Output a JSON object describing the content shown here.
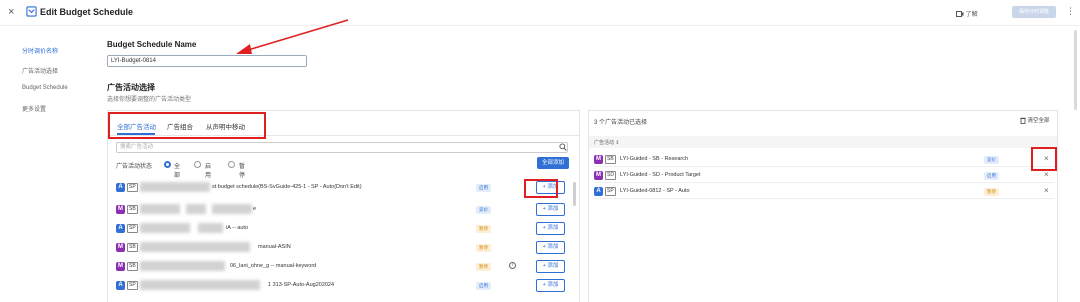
{
  "header": {
    "close": "×",
    "title": "Edit Budget Schedule",
    "help": "了解",
    "save": "保存分时调整",
    "more": "⋮"
  },
  "sidebar": {
    "items": [
      {
        "label": "分时调价名称",
        "active": true
      },
      {
        "label": "广告活动选择",
        "active": false
      },
      {
        "label": "Budget Schedule",
        "active": false
      },
      {
        "label": "更多设置",
        "active": false
      }
    ]
  },
  "schedule_name": {
    "label": "Budget Schedule Name",
    "value": "LYI-Budget-0814"
  },
  "campaign_select": {
    "label": "广告活动选择",
    "sub": "选择你想要调整的广告活动类型"
  },
  "tabs": [
    {
      "label": "全部广告活动",
      "active": true
    },
    {
      "label": "广告组合",
      "active": false
    },
    {
      "label": "从声明中移动",
      "active": false
    }
  ],
  "search": {
    "placeholder": "搜索广告活动"
  },
  "filter": {
    "label": "广告活动状态",
    "options": [
      "全部",
      "启用",
      "暂停"
    ],
    "add_all": "全部添加"
  },
  "left_rows": [
    {
      "type": "A",
      "tag": "SP",
      "name": "st budget schedule(BS-SvGuide-425-1 - SP - Auto(Don't Edit)",
      "status": "启用",
      "status_color": "#2f6fd6",
      "status_bg": "#e3ecfb",
      "add": "+ 添加"
    },
    {
      "type": "M",
      "tag": "SB",
      "name": "e",
      "status": "竞价",
      "status_color": "#2f6fd6",
      "status_bg": "#e3ecfb",
      "add": "+ 添加"
    },
    {
      "type": "A",
      "tag": "SP",
      "name": "iA -- auto",
      "status": "暂停",
      "status_color": "#d08a12",
      "status_bg": "#fdefd5",
      "add": "+ 添加"
    },
    {
      "type": "M",
      "tag": "SB",
      "name": "manual-ASIN",
      "status": "暂停",
      "status_color": "#d08a12",
      "status_bg": "#fdefd5",
      "add": "+ 添加"
    },
    {
      "type": "M",
      "tag": "SB",
      "name": "06_lani_ohne_g -- manual-keyword",
      "status": "暂停",
      "status_color": "#d08a12",
      "status_bg": "#fdefd5",
      "add": "+ 添加",
      "info": "i"
    },
    {
      "type": "A",
      "tag": "SP",
      "name": "1 313-SP-Auto-Aug202024",
      "status": "启用",
      "status_color": "#2f6fd6",
      "status_bg": "#e3ecfb",
      "add": "+ 添加"
    }
  ],
  "right_panel": {
    "title": "3 个广告活动已选择",
    "clear": "清空全部",
    "header": "广告活动 ⇕",
    "rows": [
      {
        "type": "M",
        "tag": "SB",
        "name": "LYI-Guided - SB - Research",
        "status": "竞价",
        "status_color": "#2f6fd6",
        "status_bg": "#e3ecfb",
        "remove": "×"
      },
      {
        "type": "M",
        "tag": "SD",
        "name": "LYI-Guided - SD - Product Target",
        "status": "启用",
        "status_color": "#2f6fd6",
        "status_bg": "#e3ecfb",
        "remove": "×"
      },
      {
        "type": "A",
        "tag": "SP",
        "name": "LYI-Guided-0812 - SP - Auto",
        "status": "暂停",
        "status_color": "#d08a12",
        "status_bg": "#fdefd5",
        "remove": "×"
      }
    ]
  },
  "colors": {
    "accent": "#2f6fd6",
    "type_A": "#2f6fd6",
    "type_M": "#8b2fb3",
    "highlight": "#e02020"
  }
}
